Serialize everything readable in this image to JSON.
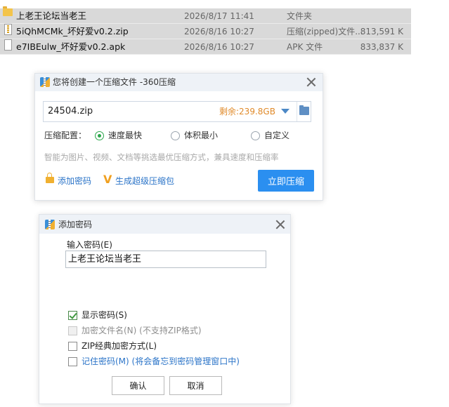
{
  "files": [
    {
      "icon": "folder-icon",
      "name": "上老王论坛当老王",
      "date": "2026/8/17 11:41",
      "type": "文件夹",
      "size": ""
    },
    {
      "icon": "zip-file-icon",
      "name": "5iQhMCMk_坏好爱v0.2.zip",
      "date": "2026/8/16 10:27",
      "type": "压缩(zipped)文件...",
      "size": "813,591 K"
    },
    {
      "icon": "apk-file-icon",
      "name": "e7IBEulw_坏好爱v0.2.apk",
      "date": "2026/8/16 10:27",
      "type": "APK 文件",
      "size": "833,837 K"
    }
  ],
  "compress_dialog": {
    "title": "您将创建一个压缩文件 -360压缩",
    "filename": "24504.zip",
    "free_space": "剩余:239.8GB",
    "config_label": "压缩配置：",
    "options": [
      {
        "label": "速度最快",
        "selected": true
      },
      {
        "label": "体积最小",
        "selected": false
      },
      {
        "label": "自定义",
        "selected": false
      }
    ],
    "hint": "智能为图片、视频、文档等挑选最优压缩方式，兼具速度和压缩率",
    "add_password_link": "添加密码",
    "super_pack_link": "生成超级压缩包",
    "compress_button": "立即压缩",
    "accent_color": "#2b8ff0"
  },
  "password_dialog": {
    "title": "添加密码",
    "input_label": "输入密码(E)",
    "password_value": "上老王论坛当老王",
    "checkboxes": [
      {
        "label": "显示密码(S)",
        "checked": true,
        "disabled": false
      },
      {
        "label": "加密文件名(N) (不支持ZIP格式)",
        "checked": false,
        "disabled": true
      },
      {
        "label": "ZIP经典加密方式(L)",
        "checked": false,
        "disabled": false
      },
      {
        "label": "记住密码(M) (将会备忘到密码管理窗口中)",
        "checked": false,
        "disabled": false
      }
    ],
    "ok_button": "确认",
    "cancel_button": "取消"
  }
}
